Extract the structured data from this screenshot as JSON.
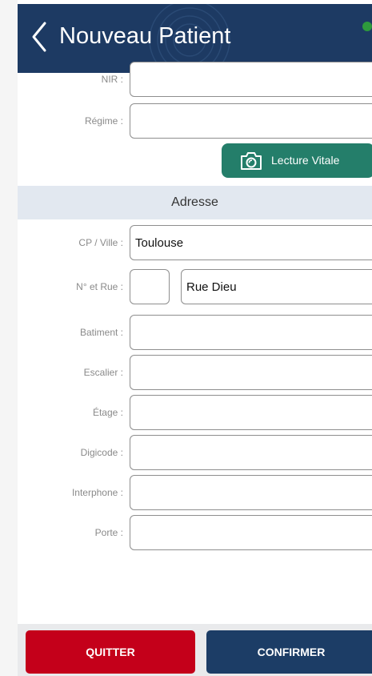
{
  "header": {
    "title": "Nouveau Patient",
    "back_icon": "chevron-left-icon",
    "status_color": "#2e9a3c",
    "background_color": "#1d3a63"
  },
  "identity": {
    "nir": {
      "label": "NIR :",
      "value": ""
    },
    "regime": {
      "label": "Régime :",
      "value": ""
    },
    "vitale_button": {
      "label": "Lecture Vitale",
      "icon": "camera-icon",
      "color": "#247e6a"
    }
  },
  "address": {
    "section_title": "Adresse",
    "cp_ville": {
      "label": "CP / Ville :",
      "value": "Toulouse"
    },
    "numero_rue": {
      "label": "N° et Rue :",
      "numero": "",
      "rue": "Rue Dieu"
    },
    "batiment": {
      "label": "Batiment :",
      "value": ""
    },
    "escalier": {
      "label": "Escalier :",
      "value": ""
    },
    "etage": {
      "label": "Étage :",
      "value": ""
    },
    "digicode": {
      "label": "Digicode :",
      "value": ""
    },
    "interphone": {
      "label": "Interphone :",
      "value": ""
    },
    "porte": {
      "label": "Porte :",
      "value": ""
    }
  },
  "footer": {
    "quit_label": "QUITTER",
    "quit_color": "#c4001a",
    "confirm_label": "CONFIRMER",
    "confirm_color": "#1c3d66"
  }
}
